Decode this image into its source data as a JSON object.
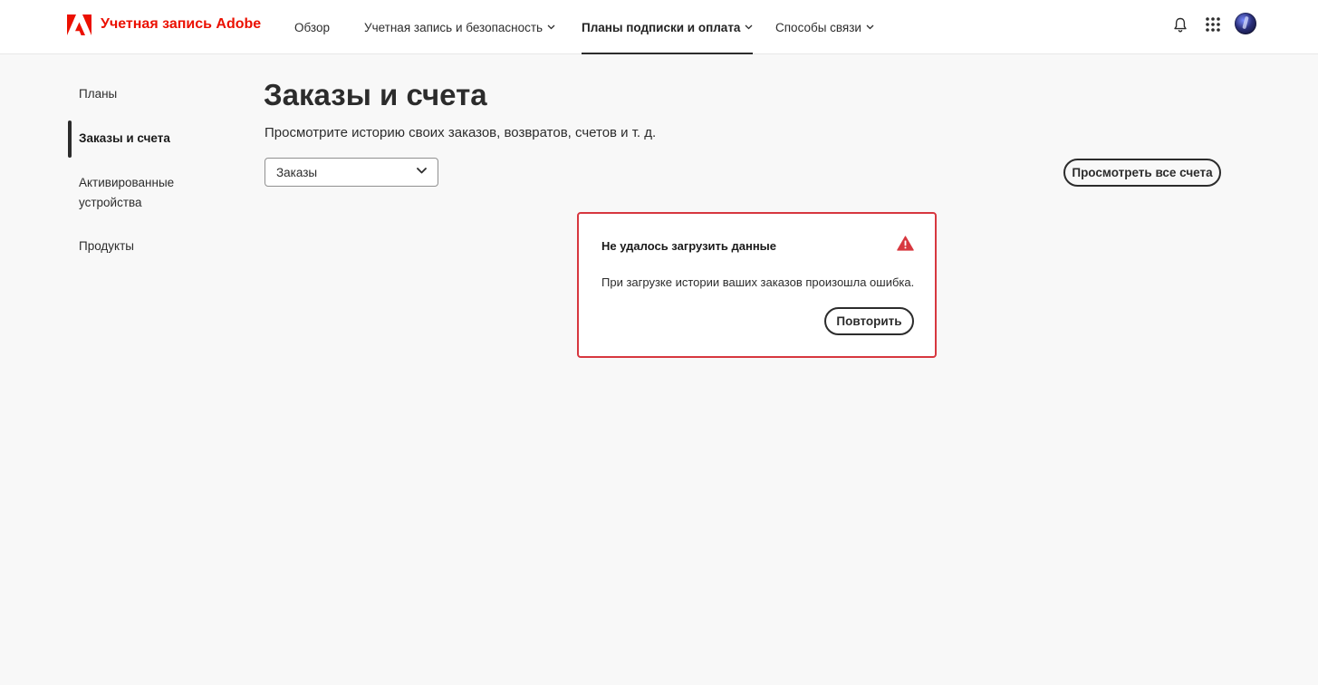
{
  "header": {
    "brand_name": "Учетная запись Adobe",
    "brand_color": "#eb1000",
    "nav": [
      {
        "label": "Обзор",
        "has_dropdown": false,
        "active": false
      },
      {
        "label": "Учетная запись и безопасность",
        "has_dropdown": true,
        "active": false
      },
      {
        "label": "Планы подписки и оплата",
        "has_dropdown": true,
        "active": true
      },
      {
        "label": "Способы связи",
        "has_dropdown": true,
        "active": false
      }
    ],
    "icons": [
      "bell-icon",
      "apps-grid-icon",
      "avatar"
    ]
  },
  "sidebar": {
    "items": [
      {
        "label": "Планы",
        "active": false
      },
      {
        "label": "Заказы и счета",
        "active": true
      },
      {
        "label": "Активированные устройства",
        "active": false
      },
      {
        "label": "Продукты",
        "active": false
      }
    ]
  },
  "main": {
    "title": "Заказы и счета",
    "subtitle": "Просмотрите историю своих заказов, возвратов, счетов и т. д.",
    "filter": {
      "selected": "Заказы"
    },
    "view_all_invoices_label": "Просмотреть все счета",
    "error": {
      "title": "Не удалось загрузить данные",
      "message": "При загрузке истории ваших заказов произошла ошибка.",
      "retry_label": "Повторить",
      "icon": "alert-triangle-icon",
      "color": "#d7373f"
    }
  }
}
